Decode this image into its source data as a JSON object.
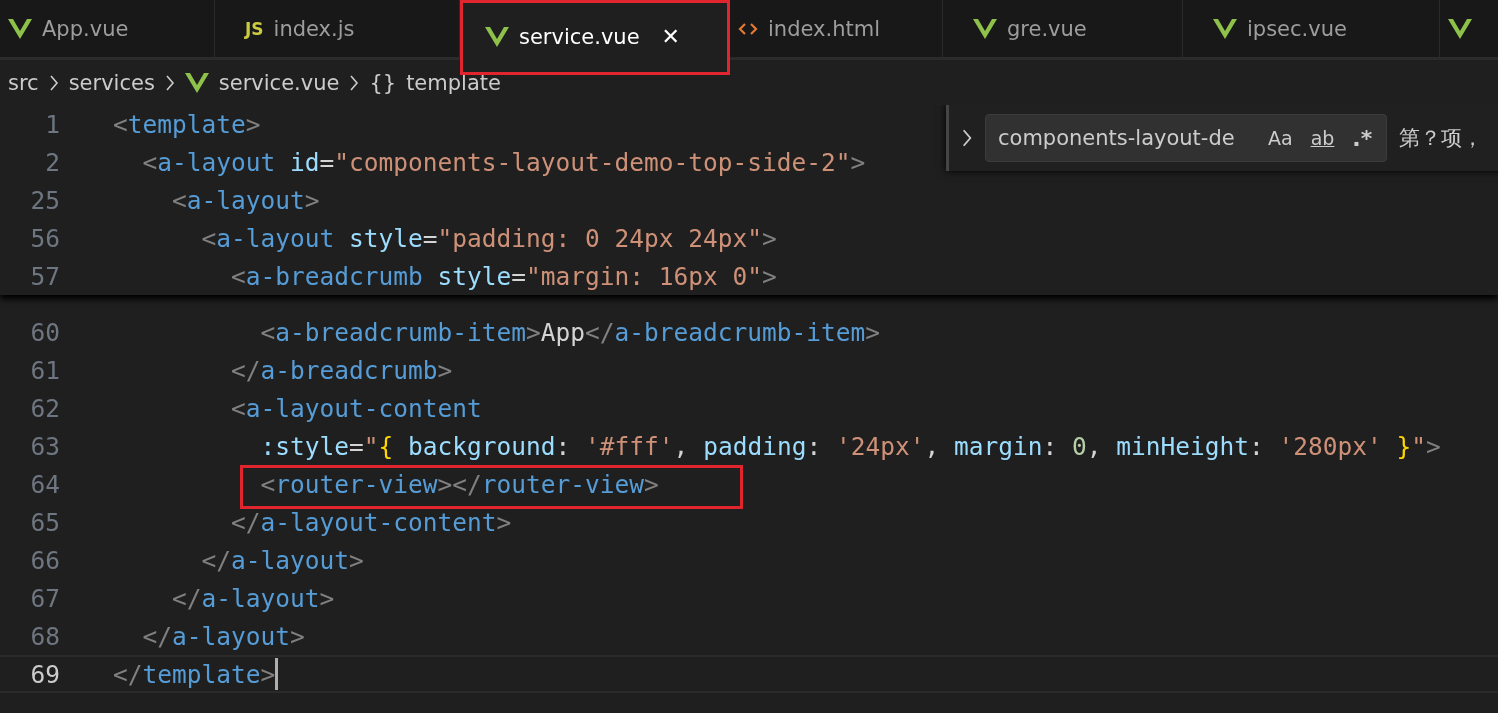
{
  "tabs": [
    {
      "kind": "vue",
      "label": "App.vue",
      "selected": false,
      "highlighted": false
    },
    {
      "kind": "js",
      "icon_text": "JS",
      "label": "index.js",
      "selected": false,
      "highlighted": false
    },
    {
      "kind": "vue",
      "label": "service.vue",
      "selected": true,
      "highlighted": true,
      "close": "✕"
    },
    {
      "kind": "html",
      "label": "index.html",
      "selected": false,
      "highlighted": false
    },
    {
      "kind": "vue",
      "label": "gre.vue",
      "selected": false,
      "highlighted": false
    },
    {
      "kind": "vue",
      "label": "ipsec.vue",
      "selected": false,
      "highlighted": false
    },
    {
      "kind": "vue",
      "selected": false,
      "highlighted": false
    }
  ],
  "breadcrumb": [
    {
      "kind": "folder",
      "label": "src"
    },
    {
      "kind": "folder",
      "label": "services"
    },
    {
      "kind": "vue",
      "label": "service.vue"
    },
    {
      "kind": "symbol",
      "icon_text": "{}",
      "label": "template"
    }
  ],
  "find_widget": {
    "value": "components-layout-de",
    "match_case": "Aa",
    "whole_word": "ab",
    "regex": ".*",
    "result": "第？项，"
  },
  "sticky_lines": [
    {
      "number": "1",
      "tokens": [
        {
          "kind": "punct",
          "text": "<"
        },
        {
          "kind": "tag",
          "text": "template"
        },
        {
          "kind": "punct",
          "text": ">"
        }
      ]
    },
    {
      "number": "2",
      "tokens": [
        {
          "kind": "punct",
          "text": "  <"
        },
        {
          "kind": "tag",
          "text": "a-layout"
        },
        {
          "kind": "attr",
          "text": " id"
        },
        {
          "kind": "text",
          "text": "="
        },
        {
          "kind": "str",
          "text": "\"components-layout-demo-top-side-2\""
        },
        {
          "kind": "punct",
          "text": ">"
        }
      ]
    },
    {
      "number": "25",
      "tokens": [
        {
          "kind": "punct",
          "text": "    <"
        },
        {
          "kind": "tag",
          "text": "a-layout"
        },
        {
          "kind": "punct",
          "text": ">"
        }
      ]
    },
    {
      "number": "56",
      "tokens": [
        {
          "kind": "punct",
          "text": "      <"
        },
        {
          "kind": "tag",
          "text": "a-layout"
        },
        {
          "kind": "attr",
          "text": " style"
        },
        {
          "kind": "text",
          "text": "="
        },
        {
          "kind": "str",
          "text": "\"padding: 0 24px 24px\""
        },
        {
          "kind": "punct",
          "text": ">"
        }
      ]
    },
    {
      "number": "57",
      "tokens": [
        {
          "kind": "punct",
          "text": "        <"
        },
        {
          "kind": "tag",
          "text": "a-breadcrumb"
        },
        {
          "kind": "attr",
          "text": " style"
        },
        {
          "kind": "text",
          "text": "="
        },
        {
          "kind": "str",
          "text": "\"margin: 16px 0\""
        },
        {
          "kind": "punct",
          "text": ">"
        }
      ]
    }
  ],
  "lines": [
    {
      "number": "60",
      "current": false,
      "highlighted": false,
      "tokens": [
        {
          "kind": "punct",
          "text": "          <"
        },
        {
          "kind": "tag",
          "text": "a-breadcrumb-item"
        },
        {
          "kind": "punct",
          "text": ">"
        },
        {
          "kind": "text",
          "text": "App"
        },
        {
          "kind": "punct",
          "text": "</"
        },
        {
          "kind": "tag",
          "text": "a-breadcrumb-item"
        },
        {
          "kind": "punct",
          "text": ">"
        }
      ]
    },
    {
      "number": "61",
      "current": false,
      "highlighted": false,
      "tokens": [
        {
          "kind": "punct",
          "text": "        </"
        },
        {
          "kind": "tag",
          "text": "a-breadcrumb"
        },
        {
          "kind": "punct",
          "text": ">"
        }
      ]
    },
    {
      "number": "62",
      "current": false,
      "highlighted": false,
      "tokens": [
        {
          "kind": "punct",
          "text": "        <"
        },
        {
          "kind": "tag",
          "text": "a-layout-content"
        }
      ]
    },
    {
      "number": "63",
      "current": false,
      "highlighted": false,
      "tokens": [
        {
          "kind": "attr",
          "text": "          :style"
        },
        {
          "kind": "text",
          "text": "="
        },
        {
          "kind": "str",
          "text": "\""
        },
        {
          "kind": "brace",
          "text": "{"
        },
        {
          "kind": "attr",
          "text": " background"
        },
        {
          "kind": "text",
          "text": ": "
        },
        {
          "kind": "str",
          "text": "'#fff'"
        },
        {
          "kind": "text",
          "text": ", "
        },
        {
          "kind": "attr",
          "text": "padding"
        },
        {
          "kind": "text",
          "text": ": "
        },
        {
          "kind": "str",
          "text": "'24px'"
        },
        {
          "kind": "text",
          "text": ", "
        },
        {
          "kind": "attr",
          "text": "margin"
        },
        {
          "kind": "text",
          "text": ": "
        },
        {
          "kind": "num",
          "text": "0"
        },
        {
          "kind": "text",
          "text": ", "
        },
        {
          "kind": "attr",
          "text": "minHeight"
        },
        {
          "kind": "text",
          "text": ": "
        },
        {
          "kind": "str",
          "text": "'280px'"
        },
        {
          "kind": "brace",
          "text": " }"
        },
        {
          "kind": "str",
          "text": "\""
        },
        {
          "kind": "punct",
          "text": ">"
        }
      ]
    },
    {
      "number": "64",
      "current": false,
      "highlighted": true,
      "tokens": [
        {
          "kind": "punct",
          "text": "          <"
        },
        {
          "kind": "tag",
          "text": "router-view"
        },
        {
          "kind": "punct",
          "text": "></"
        },
        {
          "kind": "tag",
          "text": "router-view"
        },
        {
          "kind": "punct",
          "text": ">"
        }
      ]
    },
    {
      "number": "65",
      "current": false,
      "highlighted": false,
      "tokens": [
        {
          "kind": "punct",
          "text": "        </"
        },
        {
          "kind": "tag",
          "text": "a-layout-content"
        },
        {
          "kind": "punct",
          "text": ">"
        }
      ]
    },
    {
      "number": "66",
      "current": false,
      "highlighted": false,
      "tokens": [
        {
          "kind": "punct",
          "text": "      </"
        },
        {
          "kind": "tag",
          "text": "a-layout"
        },
        {
          "kind": "punct",
          "text": ">"
        }
      ]
    },
    {
      "number": "67",
      "current": false,
      "highlighted": false,
      "tokens": [
        {
          "kind": "punct",
          "text": "    </"
        },
        {
          "kind": "tag",
          "text": "a-layout"
        },
        {
          "kind": "punct",
          "text": ">"
        }
      ]
    },
    {
      "number": "68",
      "current": false,
      "highlighted": false,
      "tokens": [
        {
          "kind": "punct",
          "text": "  </"
        },
        {
          "kind": "tag",
          "text": "a-layout"
        },
        {
          "kind": "punct",
          "text": ">"
        }
      ]
    },
    {
      "number": "69",
      "current": true,
      "highlighted": false,
      "tokens": [
        {
          "kind": "punct",
          "text": "</"
        },
        {
          "kind": "tag",
          "text": "template"
        },
        {
          "kind": "punct",
          "text": ">"
        }
      ]
    }
  ]
}
